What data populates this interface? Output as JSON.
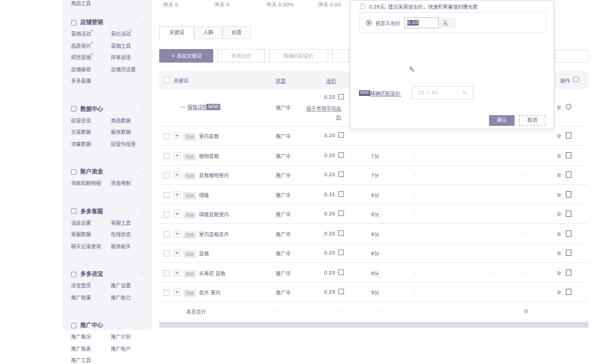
{
  "sidebar": {
    "top_item": "商品工具",
    "sections": [
      {
        "title": "店铺营销",
        "icon": "shop-icon",
        "items": [
          "营销活动",
          "竞价活动",
          "品质竞价",
          "营销工具",
          "短信营销",
          "拼单返现",
          "店铺装修",
          "店铺页设置",
          "多多直播"
        ]
      },
      {
        "title": "数据中心",
        "icon": "bar-chart-icon",
        "items": [
          "经营总览",
          "商品数据",
          "交易数据",
          "服务数据",
          "流量数据",
          "经营作战室"
        ]
      },
      {
        "title": "账户资金",
        "icon": "wallet-icon",
        "items": [
          "货款扣款明细",
          "资金限制"
        ]
      },
      {
        "title": "多多客服",
        "icon": "headset-icon",
        "items": [
          "消息设置",
          "客服工具",
          "客服数据",
          "在线状态",
          "聊天记录查询",
          "服务助手"
        ]
      },
      {
        "title": "多多进宝",
        "icon": "gear-circle-icon",
        "items": [
          "进宝首页",
          "推广设置",
          "推广效果",
          "推广助力"
        ]
      },
      {
        "title": "推广中心",
        "icon": "share-icon",
        "items": [
          "推广概况",
          "推广计划",
          "推广报表",
          "推广账户",
          "推广工具"
        ]
      }
    ]
  },
  "stats": [
    "昨天 0",
    "昨天 0",
    "昨天 0.00%",
    "昨天 0.00"
  ],
  "tabs": [
    "关键词",
    "人群",
    "创意"
  ],
  "toolbar": {
    "add": "+ 添加关键词",
    "modify_bid": "修改出价",
    "exact_premium": "精确匹配溢价"
  },
  "table": {
    "headers": {
      "keyword": "关键词",
      "status": "状态",
      "bid": "出价",
      "ops": "操作"
    },
    "smart_row": {
      "name": "智能词包",
      "tag": "NEW",
      "status": "推广中",
      "bid": "0.20",
      "note": "低于市场平均出价"
    },
    "match_tag": "精确",
    "rows": [
      {
        "keyword": "室内盆栽",
        "status": "推广中",
        "bid": "0.20",
        "score": ""
      },
      {
        "keyword": "植物盆栽",
        "status": "推广中",
        "bid": "0.20",
        "score": "7分"
      },
      {
        "keyword": "盆栽植物室内",
        "status": "推广中",
        "bid": "0.20",
        "score": "7分"
      },
      {
        "keyword": "绿植",
        "status": "推广中",
        "bid": "0.31",
        "score": "8分"
      },
      {
        "keyword": "绿植盆栽室内",
        "status": "推广中",
        "bid": "0.20",
        "score": "8分"
      },
      {
        "keyword": "室内盆栽花卉",
        "status": "推广中",
        "bid": "0.20",
        "score": "8分"
      },
      {
        "keyword": "盆栽",
        "status": "推广中",
        "bid": "0.20",
        "score": "8分"
      },
      {
        "keyword": "长寿花 盆栽",
        "status": "推广中",
        "bid": "0.20",
        "score": "8分"
      },
      {
        "keyword": "花卉 室内",
        "status": "推广中",
        "bid": "0.29",
        "score": "9分"
      }
    ],
    "total": {
      "label": "本页合计",
      "last": "0"
    }
  },
  "modal": {
    "suggest": "0.26元: 建议采用该出价，快速积累量值的曝光数",
    "custom_label": "自定义出价",
    "custom_value": "0.20",
    "unit": "元",
    "premium_tag": "NEW",
    "premium_label": "精确匹配溢价:",
    "premium_placeholder": "10 ~ 50",
    "premium_unit": "%",
    "confirm": "确认",
    "cancel": "取消"
  }
}
